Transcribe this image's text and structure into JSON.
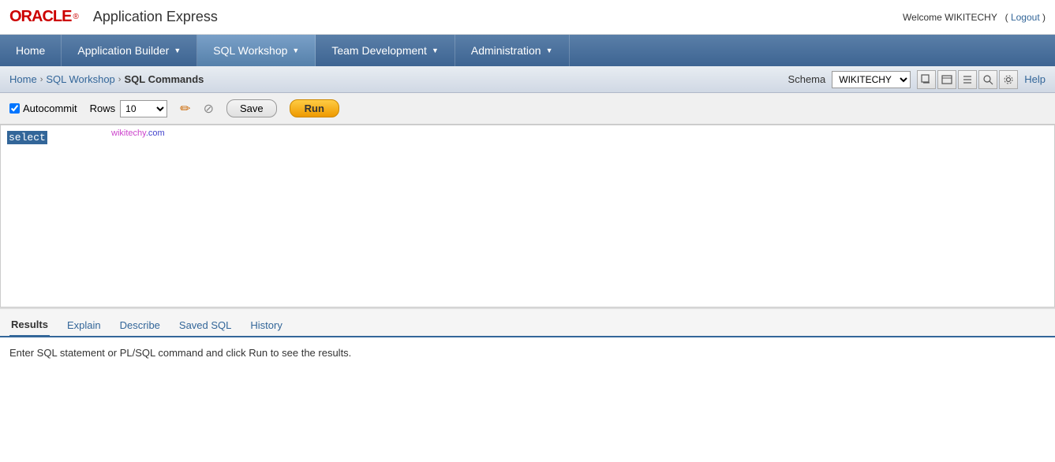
{
  "header": {
    "oracle_text": "ORACLE",
    "app_express": "Application Express",
    "welcome": "Welcome WIKITECHY",
    "logout_label": "Logout"
  },
  "nav": {
    "items": [
      {
        "label": "Home",
        "has_arrow": false,
        "active": false
      },
      {
        "label": "Application Builder",
        "has_arrow": true,
        "active": false
      },
      {
        "label": "SQL Workshop",
        "has_arrow": true,
        "active": true
      },
      {
        "label": "Team Development",
        "has_arrow": true,
        "active": false
      },
      {
        "label": "Administration",
        "has_arrow": true,
        "active": false
      }
    ]
  },
  "breadcrumb": {
    "items": [
      "Home",
      "SQL Workshop"
    ],
    "current": "SQL Commands"
  },
  "schema": {
    "label": "Schema",
    "value": "WIKITECHY"
  },
  "toolbar": {
    "help_label": "Help",
    "autocommit_label": "Autocommit",
    "rows_label": "Rows",
    "rows_value": "10",
    "save_label": "Save",
    "run_label": "Run"
  },
  "watermark": {
    "part1": "wikitechy",
    "part2": ".com"
  },
  "editor": {
    "content": "select"
  },
  "tabs": {
    "items": [
      {
        "label": "Results",
        "active": true
      },
      {
        "label": "Explain",
        "active": false
      },
      {
        "label": "Describe",
        "active": false
      },
      {
        "label": "Saved SQL",
        "active": false
      },
      {
        "label": "History",
        "active": false
      }
    ]
  },
  "results": {
    "message": "Enter SQL statement or PL/SQL command and click Run to see the results."
  }
}
